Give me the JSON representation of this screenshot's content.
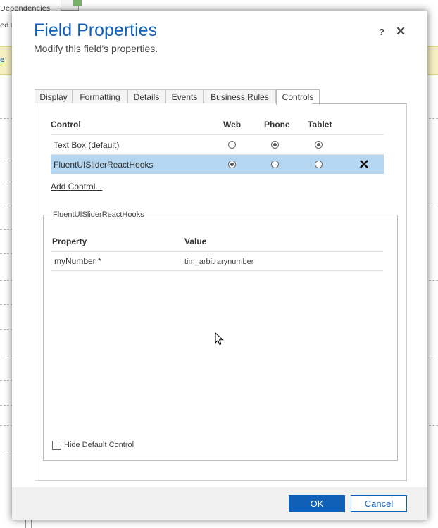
{
  "background": {
    "dependencies_label": "Dependencies",
    "partial_label": "ed R",
    "link_fragment": "e"
  },
  "dialog": {
    "title": "Field Properties",
    "subtitle": "Modify this field's properties.",
    "help_label": "?",
    "close_label": "✕"
  },
  "tabs": [
    {
      "label": "Display"
    },
    {
      "label": "Formatting"
    },
    {
      "label": "Details"
    },
    {
      "label": "Events"
    },
    {
      "label": "Business Rules"
    },
    {
      "label": "Controls",
      "active": true
    }
  ],
  "controls_table": {
    "headers": {
      "control": "Control",
      "web": "Web",
      "phone": "Phone",
      "tablet": "Tablet"
    },
    "rows": [
      {
        "name": "Text Box (default)",
        "web": false,
        "phone": true,
        "tablet": true,
        "selected": false
      },
      {
        "name": "FluentUISliderReactHooks",
        "web": true,
        "phone": false,
        "tablet": false,
        "selected": true,
        "remove_label": "✕"
      }
    ],
    "add_control_label": "Add Control..."
  },
  "properties": {
    "legend": "FluentUISliderReactHooks",
    "headers": {
      "property": "Property",
      "value": "Value"
    },
    "rows": [
      {
        "name": "myNumber",
        "required_marker": "*",
        "value": "tim_arbitrarynumber"
      }
    ],
    "hide_default_label": "Hide Default Control",
    "hide_default_checked": false
  },
  "footer": {
    "ok_label": "OK",
    "cancel_label": "Cancel"
  },
  "colors": {
    "accent": "#1160b7",
    "selected_row": "#b5d6f0",
    "background_banner": "#f7f0c3"
  },
  "icons": [
    "help-icon",
    "close-icon",
    "remove-control-icon",
    "document-icon",
    "mouse-cursor-icon"
  ]
}
